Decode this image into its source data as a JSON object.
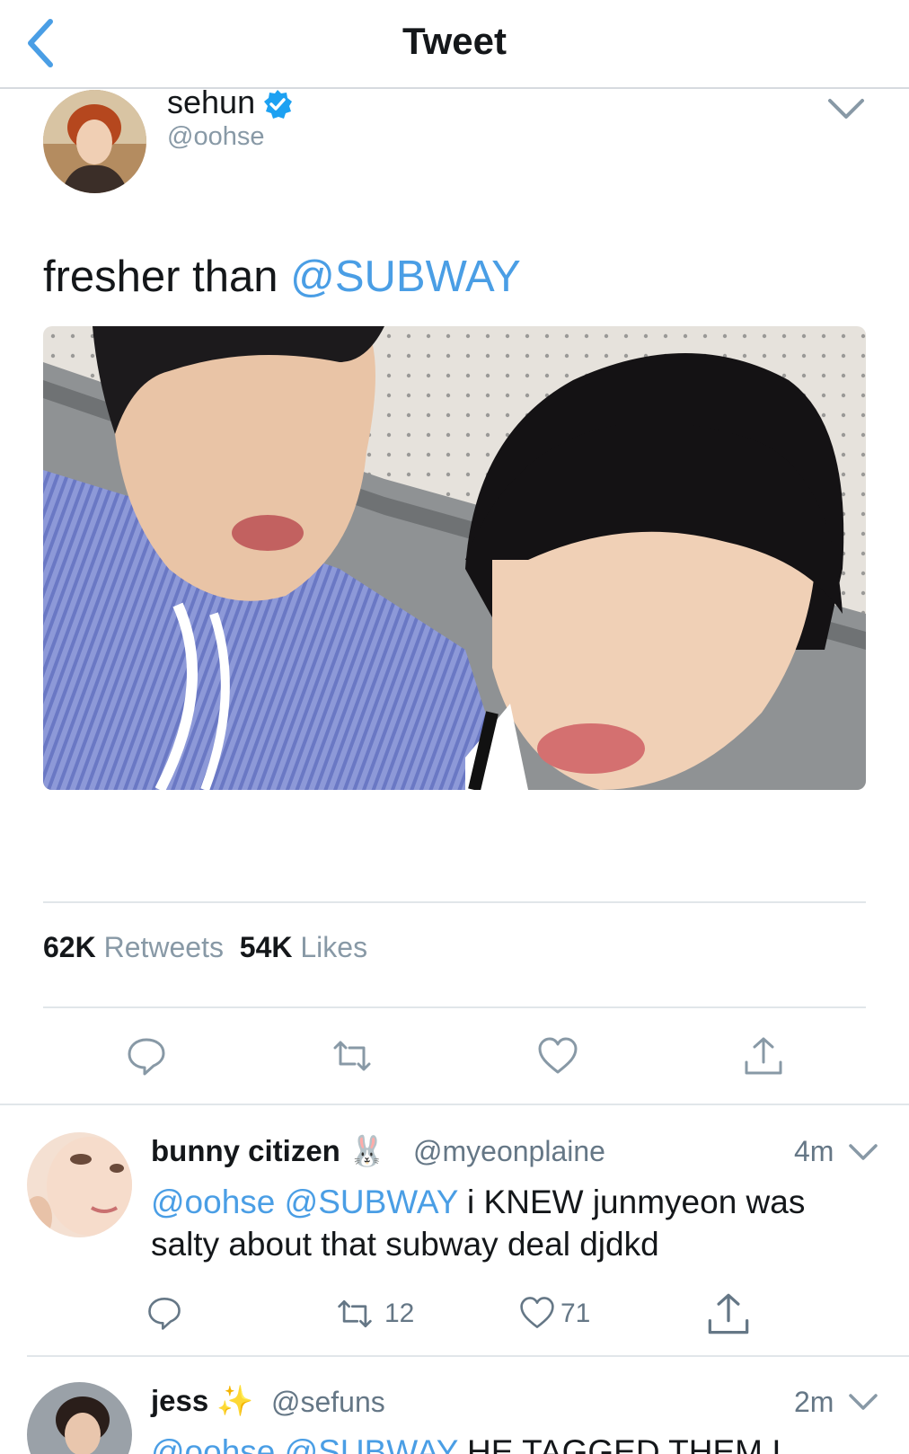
{
  "header": {
    "title": "Tweet"
  },
  "tweet": {
    "author_name": "sehun",
    "author_handle": "@oohse",
    "text_plain": "fresher than ",
    "text_mention": "@SUBWAY",
    "retweets_count": "62K",
    "retweets_label": "Retweets",
    "likes_count": "54K",
    "likes_label": "Likes"
  },
  "replies": [
    {
      "name": "bunny citizen",
      "emoji": "🐰",
      "handle": "@myeonplaine",
      "time": "4m",
      "mentions": "@oohse @SUBWAY",
      "text": " i KNEW junmyeon was salty about that subway deal djdkd",
      "retweet_count": "12",
      "like_count": "71"
    },
    {
      "name": "jess",
      "emoji": "✨",
      "handle": "@sefuns",
      "time": "2m",
      "mentions": "@oohse @SUBWAY",
      "text": " HE TAGGED THEM I"
    }
  ],
  "colors": {
    "accent": "#4a9ee5",
    "secondary_text": "#8899a6",
    "divider": "#e1e6ea"
  }
}
